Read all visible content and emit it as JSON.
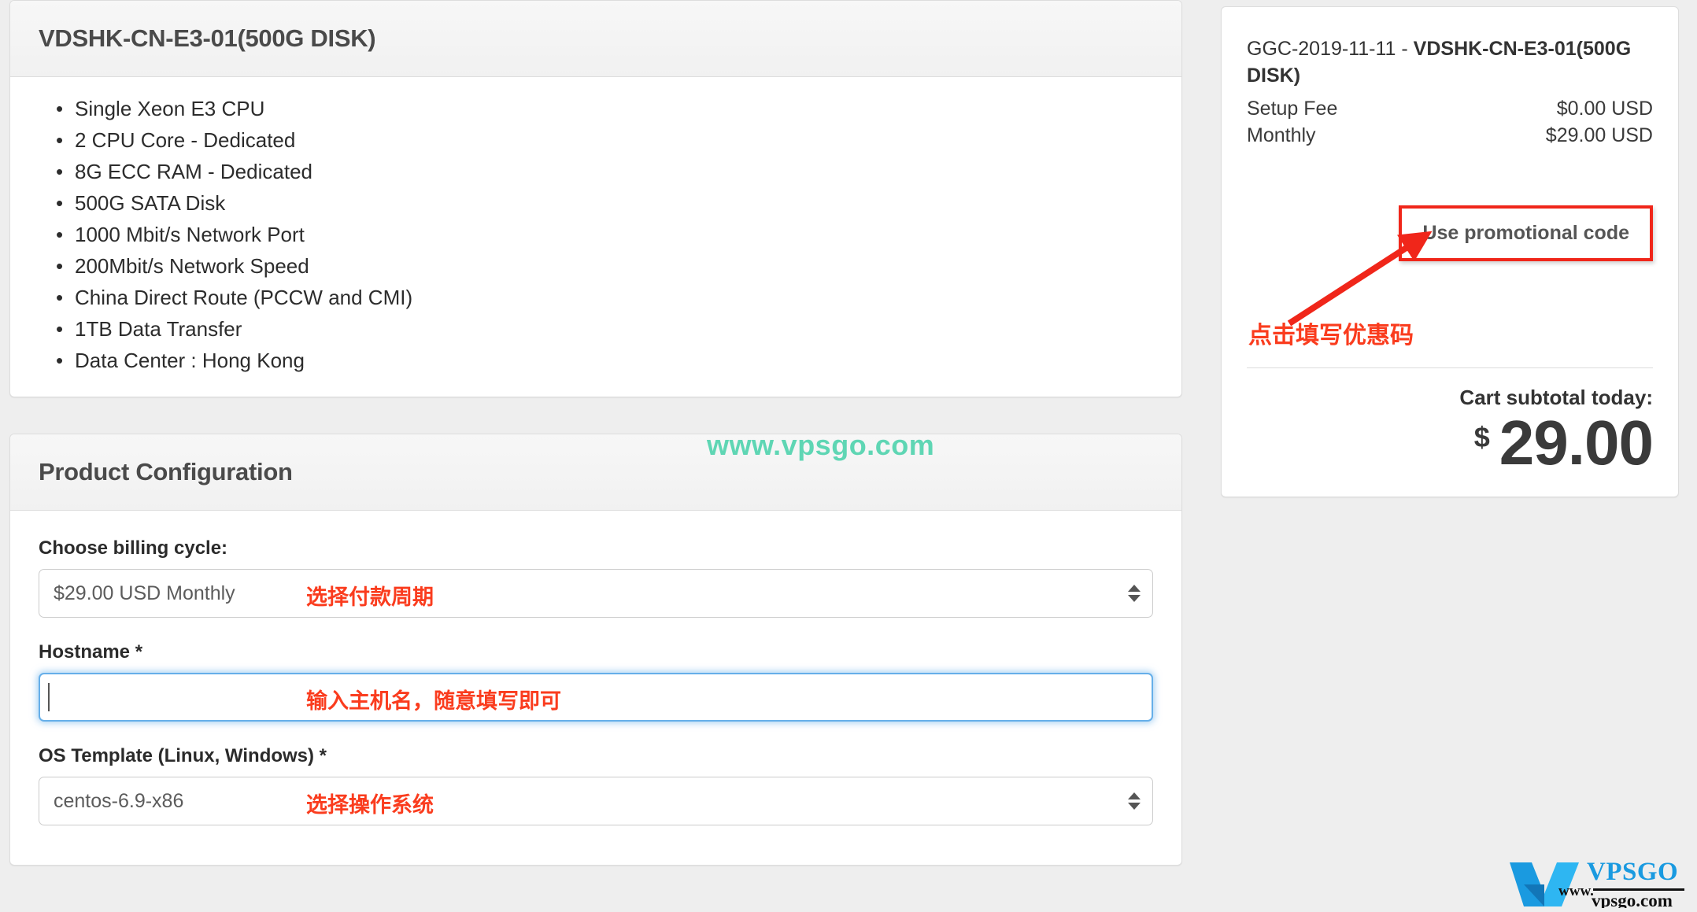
{
  "product_panel": {
    "title": "VDSHK-CN-E3-01(500G DISK)",
    "features": [
      "Single Xeon E3 CPU",
      "2 CPU Core - Dedicated",
      "8G ECC RAM - Dedicated",
      "500G SATA Disk",
      "1000 Mbit/s Network Port",
      "200Mbit/s  Network Speed",
      "China Direct Route (PCCW and CMI)",
      "1TB Data Transfer",
      "Data Center : Hong Kong"
    ]
  },
  "config_panel": {
    "title": "Product Configuration",
    "billing_cycle": {
      "label": "Choose billing cycle:",
      "value": "$29.00 USD Monthly",
      "annotation": "选择付款周期"
    },
    "hostname": {
      "label": "Hostname *",
      "value": "",
      "annotation": "输入主机名，随意填写即可"
    },
    "os_template": {
      "label": "OS Template (Linux, Windows) *",
      "value": "centos-6.9-x86",
      "annotation": "选择操作系统"
    }
  },
  "cart": {
    "item_prefix": "GGC-2019-11-11 - ",
    "item_name": "VDSHK-CN-E3-01(500G DISK)",
    "setup_fee_label": "Setup Fee",
    "setup_fee_value": "$0.00 USD",
    "monthly_label": "Monthly",
    "monthly_value": "$29.00 USD",
    "promo_button_label": "Use promotional code",
    "promo_annotation": "点击填写优惠码",
    "subtotal_label": "Cart subtotal today:",
    "subtotal_currency": "$",
    "subtotal_amount": "29.00"
  },
  "watermark": {
    "center_text": "www.vpsgo.com",
    "logo_brand": "VPSGO",
    "logo_www": "www.",
    "logo_domain": "vpsgo.com"
  },
  "colors": {
    "annotation_red": "#fa3c1e",
    "promo_border_red": "#f0261a",
    "watermark_teal": "#5fd6b4",
    "logo_blue": "#1a9ae0",
    "focus_blue": "#66afe9"
  }
}
